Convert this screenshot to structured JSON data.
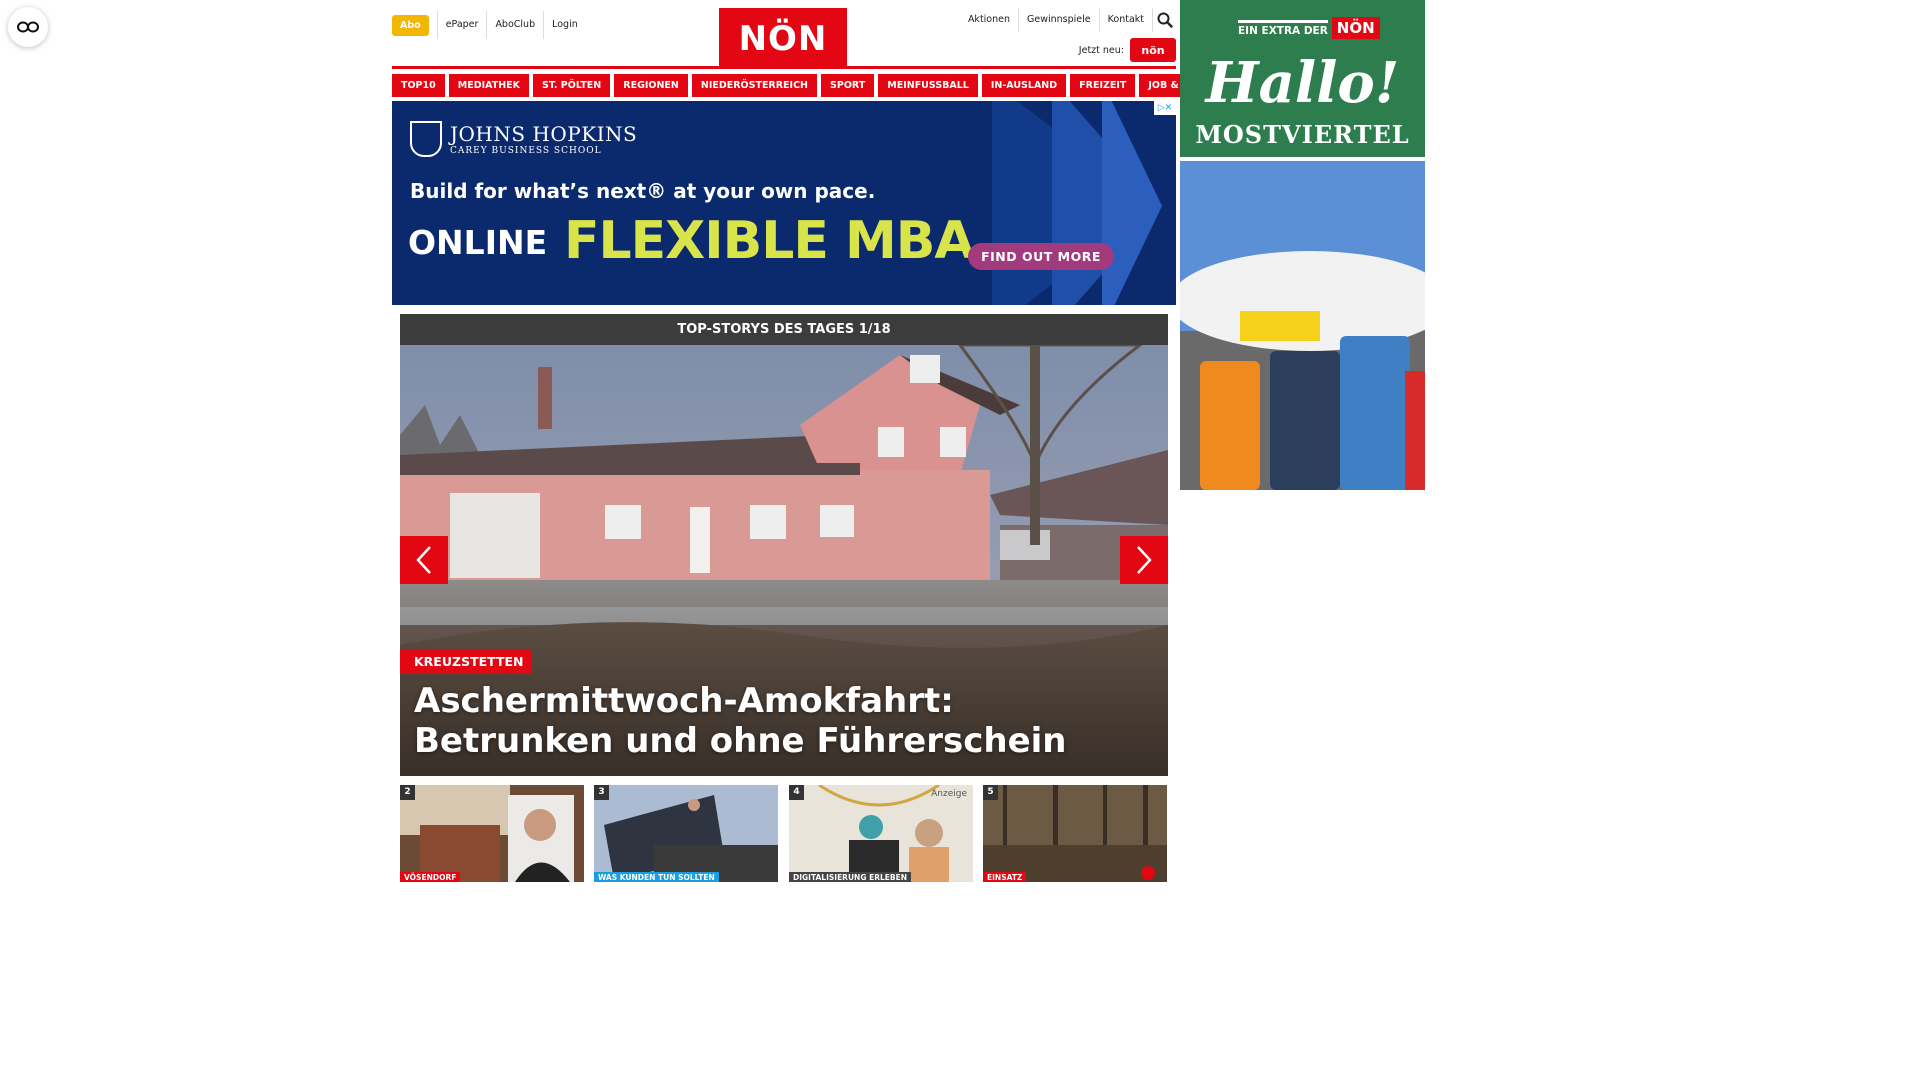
{
  "reader": {
    "icon": "reader-mode-icon"
  },
  "header": {
    "abo": "Abo",
    "links_left": [
      "ePaper",
      "AboClub",
      "Login"
    ],
    "logo": "NÖN",
    "links_right": [
      "Aktionen",
      "Gewinnspiele",
      "Kontakt"
    ],
    "search_icon": "search-icon",
    "jetzt_label": "Jetzt neu:",
    "jetzt_badge": "nön"
  },
  "nav": [
    "TOP10",
    "MEDIATHEK",
    "ST. PÖLTEN",
    "REGIONEN",
    "NIEDERÖSTERREICH",
    "SPORT",
    "MEINFUSSBALL",
    "IN-AUSLAND",
    "FREIZEIT",
    "JOB & KARRIERE"
  ],
  "ad": {
    "brand": "JOHNS HOPKINS",
    "school": "CAREY BUSINESS SCHOOL",
    "headline": "Build for what’s next® at your own pace.",
    "online": "ONLINE",
    "program": "FLEXIBLE MBA",
    "cta": "FIND OUT MORE",
    "colors": {
      "bg": "#0b2a6e",
      "accent": "#d9e34a",
      "cta": "#a23a7e"
    }
  },
  "top_stories": {
    "header": "TOP-STORYS DES TAGES 1/18",
    "hero": {
      "tag": "KREUZSTETTEN",
      "title": "Aschermittwoch-Amokfahrt: Betrunken und ohne Führerschein"
    },
    "thumbs": [
      {
        "num": "2",
        "tag": "VÖSENDORF",
        "tag_color": "#e30613"
      },
      {
        "num": "3",
        "tag": "WAS KUNDEN TUN SOLLTEN",
        "tag_color": "#1a9ee0"
      },
      {
        "num": "4",
        "tag": "DIGITALISIERUNG ERLEBEN",
        "tag_color": "#444444",
        "badge": "Anzeige"
      },
      {
        "num": "5",
        "tag": "EINSATZ",
        "tag_color": "#e30613"
      }
    ]
  },
  "side_ad": {
    "extra": "EIN EXTRA DER",
    "non": "NÖN",
    "hallo": "Hallo!",
    "region": "MOSTVIERTEL"
  },
  "colors": {
    "brand_red": "#e30613",
    "abo_yellow": "#f2b705",
    "dark_header": "#3c3c3c"
  }
}
